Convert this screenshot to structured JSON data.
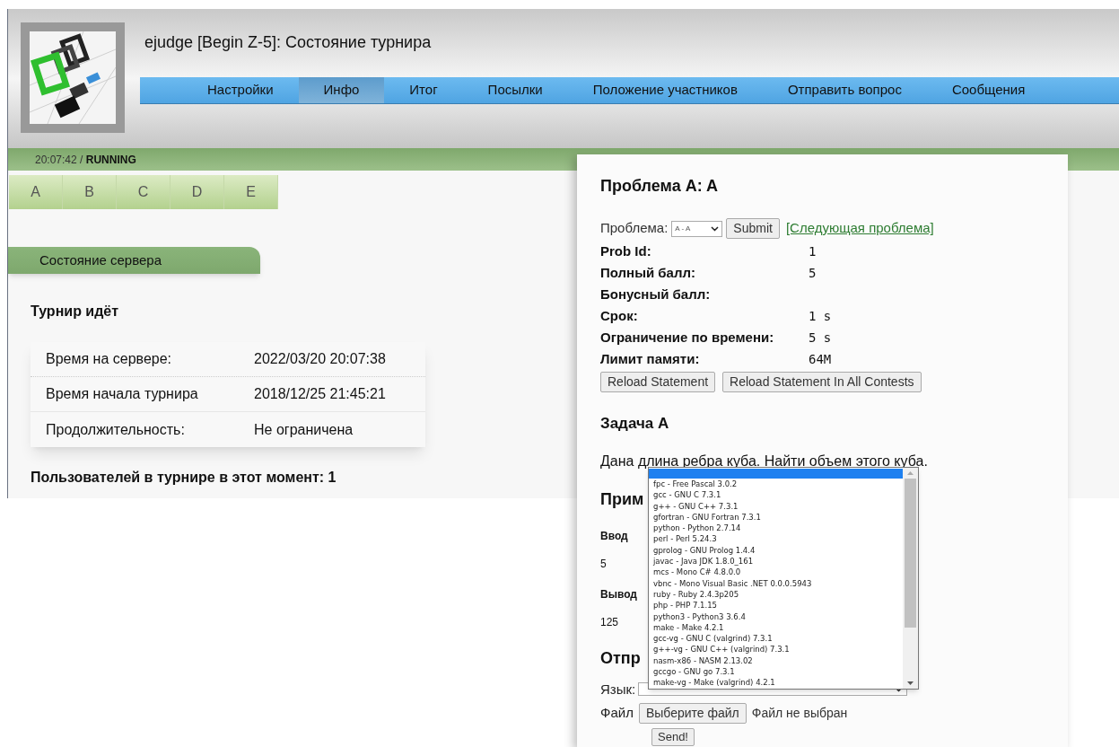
{
  "header": {
    "title": "ejudge [Begin Z-5]: Состояние турнира"
  },
  "nav": [
    {
      "label": "Настройки",
      "selected": false
    },
    {
      "label": "Инфо",
      "selected": true
    },
    {
      "label": "Итог",
      "selected": false
    },
    {
      "label": "Посылки",
      "selected": false
    },
    {
      "label": "Положение участников",
      "selected": false
    },
    {
      "label": "Отправить вопрос",
      "selected": false
    },
    {
      "label": "Сообщения",
      "selected": false
    }
  ],
  "status_bar": {
    "time": "20:07:42 /",
    "state": "RUNNING"
  },
  "problem_tabs": [
    "A",
    "B",
    "C",
    "D",
    "E"
  ],
  "server_section": {
    "title": "Состояние сервера",
    "heading": "Турнир идёт",
    "rows": [
      {
        "label": "Время на сервере:",
        "value": "2022/03/20 20:07:38"
      },
      {
        "label": "Время начала турнира",
        "value": "2018/12/25 21:45:21"
      },
      {
        "label": "Продолжительность:",
        "value": "Не ограничена"
      }
    ],
    "users": "Пользователей в турнире в этот момент: 1"
  },
  "problem_panel": {
    "title": "Проблема A: A",
    "selector_label": "Проблема:",
    "selector_value": "A - A",
    "submit": "Submit",
    "next_link": "[Следующая проблема]",
    "props": [
      {
        "label": "Prob Id:",
        "value": "1"
      },
      {
        "label": "Полный балл:",
        "value": "5"
      },
      {
        "label": "Бонусный балл:"
      },
      {
        "label": "Срок:",
        "value": "1 s"
      },
      {
        "label": "Ограничение по времени:",
        "value": "5 s"
      },
      {
        "label": "Лимит памяти:",
        "value": "64M"
      }
    ],
    "buttons": [
      "Reload Statement",
      "Reload Statement In All Contests"
    ],
    "statement_title": "Задача A",
    "statement": "Дана длина ребра куба. Найти объем этого куба.",
    "examples_title": "Прим",
    "input_label": "Ввод",
    "input_value": "5",
    "output_label": "Вывод",
    "output_value": "125",
    "submit_title": "Отпр",
    "language_label": "Язык:",
    "file_label": "Файл",
    "file_button": "Выберите файл",
    "file_status": "Файл не выбран",
    "send": "Send!"
  },
  "language_dropdown": {
    "blank_option": {
      "selected": true
    },
    "options": [
      "fpc - Free Pascal 3.0.2",
      "gcc - GNU C 7.3.1",
      "g++ - GNU C++ 7.3.1",
      "gfortran - GNU Fortran 7.3.1",
      "python - Python 2.7.14",
      "perl - Perl 5.24.3",
      "gprolog - GNU Prolog 1.4.4",
      "javac - Java JDK 1.8.0_161",
      "mcs - Mono C# 4.8.0.0",
      "vbnc - Mono Visual Basic .NET 0.0.0.5943",
      "ruby - Ruby 2.4.3p205",
      "php - PHP 7.1.15",
      "python3 - Python3 3.6.4",
      "make - Make 4.2.1",
      "gcc-vg - GNU C (valgrind) 7.3.1",
      "g++-vg - GNU C++ (valgrind) 7.3.1",
      "nasm-x86 - NASM 2.13.02",
      "gccgo - GNU go 7.3.1",
      "make-vg - Make (valgrind) 4.2.1"
    ]
  }
}
